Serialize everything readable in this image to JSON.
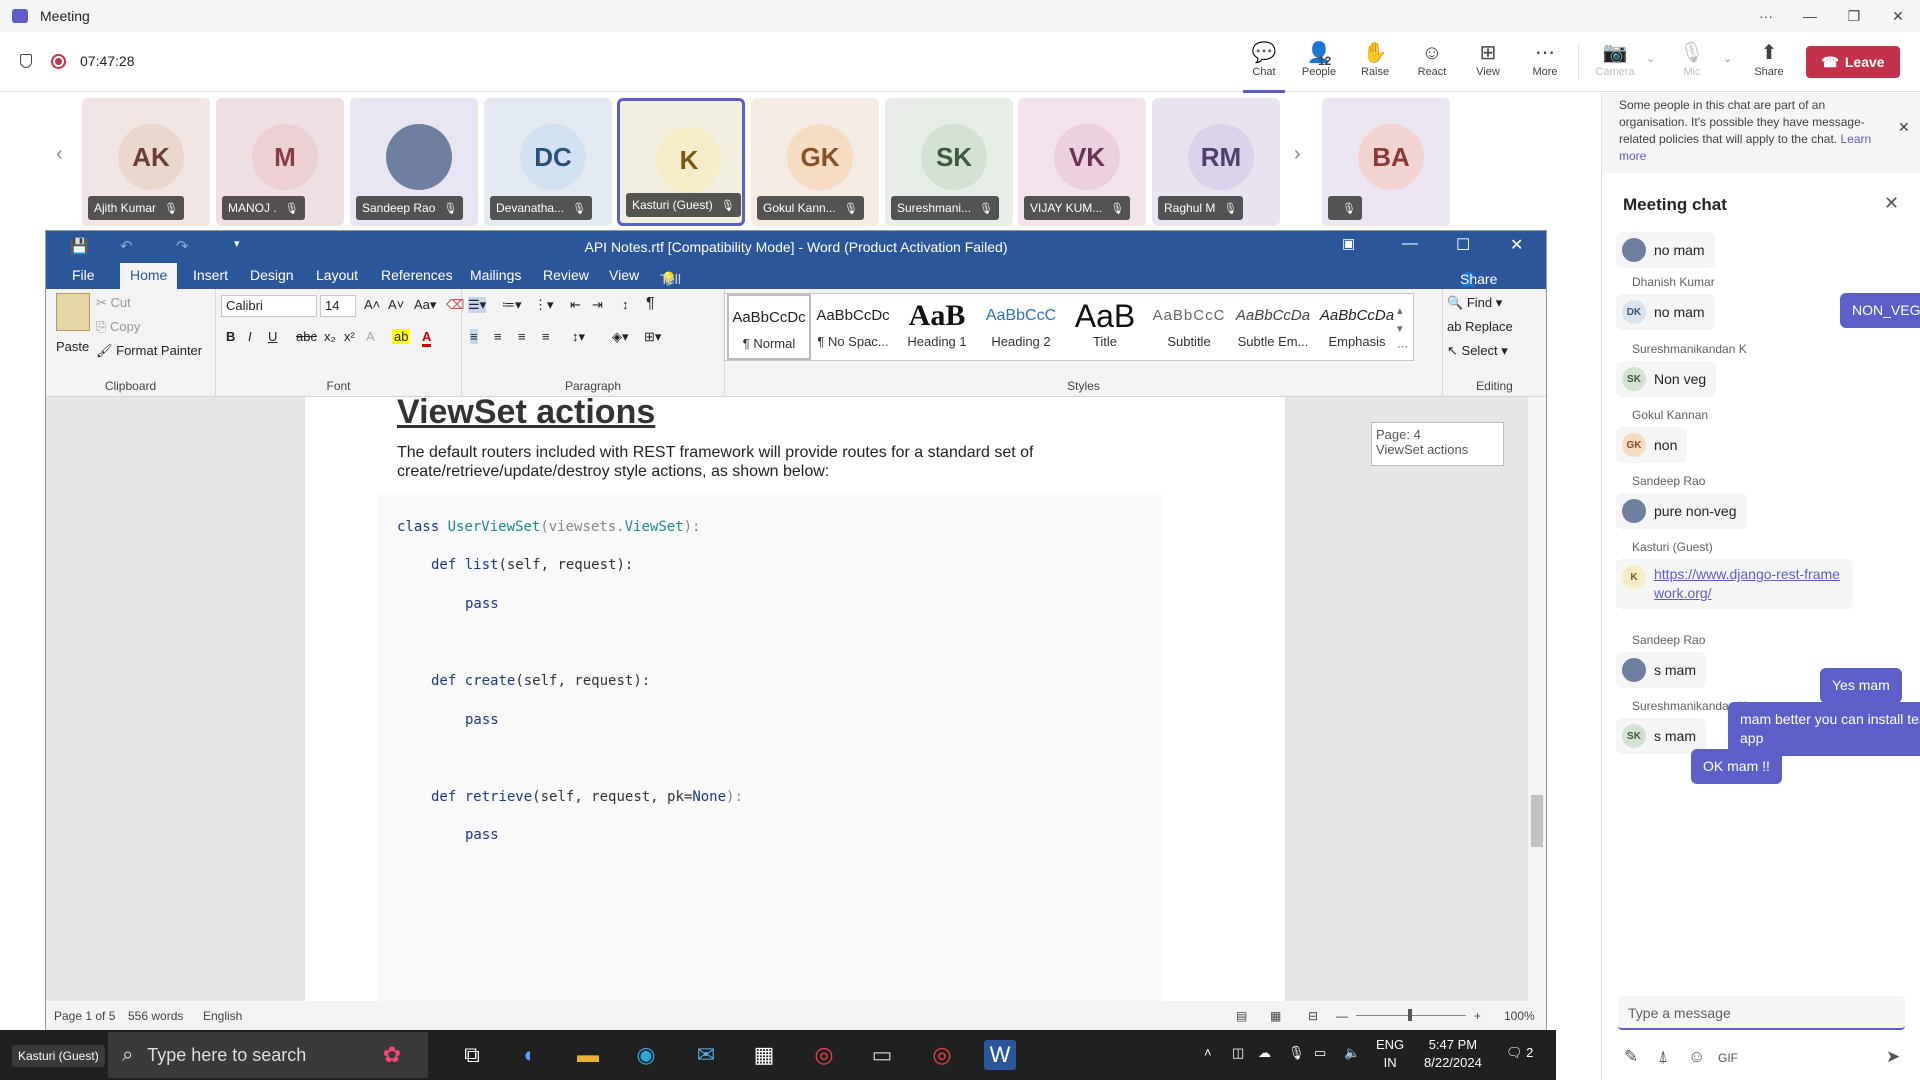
{
  "titlebar": {
    "title": "Meeting"
  },
  "meeting": {
    "timer": "07:47:28",
    "people_count": "12",
    "leave_label": "Leave"
  },
  "toolbar": [
    {
      "id": "chat",
      "label": "Chat",
      "icon": "chat-icon",
      "glyph": "💬"
    },
    {
      "id": "people",
      "label": "People",
      "icon": "people-icon",
      "glyph": "👤"
    },
    {
      "id": "raise",
      "label": "Raise",
      "icon": "hand-icon",
      "glyph": "✋"
    },
    {
      "id": "react",
      "label": "React",
      "icon": "smiley-icon",
      "glyph": "☺"
    },
    {
      "id": "view",
      "label": "View",
      "icon": "grid-icon",
      "glyph": "⊞"
    },
    {
      "id": "more",
      "label": "More",
      "icon": "ellipsis-icon",
      "glyph": "⋯"
    },
    {
      "id": "camera",
      "label": "Camera",
      "icon": "camera-off-icon",
      "glyph": "📷"
    },
    {
      "id": "mic",
      "label": "Mic",
      "icon": "mic-off-icon",
      "glyph": "🎙"
    },
    {
      "id": "share",
      "label": "Share",
      "icon": "share-icon",
      "glyph": "⬆"
    }
  ],
  "participants": [
    {
      "initials": "AK",
      "name": "Ajith Kumar",
      "bg": "#f1e6e3",
      "av": "#ecd7cf",
      "fg": "#6b3f32"
    },
    {
      "initials": "M",
      "name": "MANOJ .",
      "bg": "#efe0e3",
      "av": "#ecd0d4",
      "fg": "#8a3b44"
    },
    {
      "initials": "",
      "name": "Sandeep Rao",
      "bg": "#e7e6f2",
      "av": "#6e7fa0",
      "fg": "#fff"
    },
    {
      "initials": "DC",
      "name": "Devanatha...",
      "bg": "#e4eaf2",
      "av": "#d3e2f2",
      "fg": "#27507a"
    },
    {
      "initials": "K",
      "name": "Kasturi (Guest)",
      "bg": "#f3efe0",
      "av": "#f6ecc7",
      "fg": "#7a5a12"
    },
    {
      "initials": "GK",
      "name": "Gokul Kann...",
      "bg": "#f4ebe3",
      "av": "#f6dcc2",
      "fg": "#8a5022"
    },
    {
      "initials": "SK",
      "name": "Sureshmani...",
      "bg": "#e7ede7",
      "av": "#d4e2d4",
      "fg": "#3d5a3d"
    },
    {
      "initials": "VK",
      "name": "VIJAY KUM...",
      "bg": "#f2e3ec",
      "av": "#ecd0df",
      "fg": "#6b3355"
    },
    {
      "initials": "RM",
      "name": "Raghul M",
      "bg": "#e9e4f0",
      "av": "#dcd2ec",
      "fg": "#4e3f6d"
    },
    {
      "initials": "BA",
      "name": "",
      "bg": "#ece6f2",
      "av": "#f3d4d2",
      "fg": "#8a3b34"
    }
  ],
  "word": {
    "title": "API Notes.rtf [Compatibility Mode] - Word (Product Activation Failed)",
    "tabs": [
      "File",
      "Home",
      "Insert",
      "Design",
      "Layout",
      "References",
      "Mailings",
      "Review",
      "View"
    ],
    "tellme": "Tell me what you want to do...",
    "share": "Share",
    "clipboard": {
      "paste": "Paste",
      "cut": "Cut",
      "copy": "Copy",
      "format_painter": "Format Painter",
      "group": "Clipboard"
    },
    "font": {
      "name": "Calibri",
      "size": "14",
      "group": "Font"
    },
    "paragraph": {
      "group": "Paragraph"
    },
    "styles": {
      "group": "Styles",
      "items": [
        {
          "preview": "AaBbCcDc",
          "label": "¶ Normal"
        },
        {
          "preview": "AaBbCcDc",
          "label": "¶ No Spac..."
        },
        {
          "preview": "AaB",
          "label": "Heading 1"
        },
        {
          "preview": "AaBbCcC",
          "label": "Heading 2"
        },
        {
          "preview": "AaB",
          "label": "Title"
        },
        {
          "preview": "AaBbCcC",
          "label": "Subtitle"
        },
        {
          "preview": "AaBbCcDa",
          "label": "Subtle Em..."
        },
        {
          "preview": "AaBbCcDa",
          "label": "Emphasis"
        }
      ]
    },
    "editing": {
      "find": "Find",
      "replace": "Replace",
      "select": "Select",
      "group": "Editing"
    },
    "doc": {
      "heading": "ViewSet actions",
      "para": "The default routers included with REST framework will provide routes for a standard set of create/retrieve/update/destroy style actions, as shown below:",
      "code": {
        "l1a": "class",
        "l1b": "UserViewSet",
        "l1c": "(viewsets.",
        "l1d": "ViewSet",
        "l1e": "):",
        "l2a": "def",
        "l2b": "list",
        "l2c": "(self, request):",
        "p1": "pass",
        "l3a": "def",
        "l3b": "create",
        "l3c": "(self, request):",
        "p2": "pass",
        "l4a": "def",
        "l4b": "retrieve",
        "l4c": "(self, request, pk=",
        "l4d": "None",
        "l4e": "):",
        "p3": "pass"
      }
    },
    "nav_tooltip": {
      "page": "Page: 4",
      "heading": "ViewSet actions"
    },
    "status": {
      "page": "Page 1 of 5",
      "words": "556 words",
      "lang": "English",
      "zoom": "100%"
    }
  },
  "chat": {
    "banner": "Some people in this chat are part of an organisation. It's possible they have message-related policies that will apply to the chat.",
    "banner_link": "Learn more",
    "header": "Meeting chat",
    "messages": [
      {
        "sender": "",
        "text": "no mam",
        "initials": "",
        "photo": true
      },
      {
        "sender": "Dhanish Kumar",
        "text": "no mam",
        "initials": "DK"
      },
      {
        "sender": "Sureshmanikandan K",
        "text": "Non veg",
        "initials": "SK"
      },
      {
        "sender": "Gokul Kannan",
        "text": "non",
        "initials": "GK"
      },
      {
        "sender": "Sandeep Rao",
        "text": "pure non-veg",
        "initials": "",
        "photo": true
      },
      {
        "sender": "Kasturi (Guest)",
        "text": "https://www.django-rest-framework.org/",
        "initials": "K"
      },
      {
        "sender": "Sandeep Rao",
        "text": "s mam",
        "initials": "",
        "photo": true
      },
      {
        "sender": "Sureshmanikandan K",
        "text": "s mam",
        "initials": "SK"
      }
    ],
    "own": [
      {
        "text": "NON_VEG"
      },
      {
        "text": "Yes mam"
      },
      {
        "text": "mam better you can install team app"
      },
      {
        "text": "OK mam !!"
      }
    ],
    "compose_placeholder": "Type a message"
  },
  "taskbar": {
    "search": "Type here to search",
    "lang1": "ENG",
    "lang2": "IN",
    "time": "5:47 PM",
    "date": "8/22/2024",
    "notif": "2",
    "guest_label": "Kasturi (Guest)"
  },
  "colors": {
    "accent": "#5b5fc7",
    "leave": "#c4314b",
    "word": "#2b579a"
  }
}
